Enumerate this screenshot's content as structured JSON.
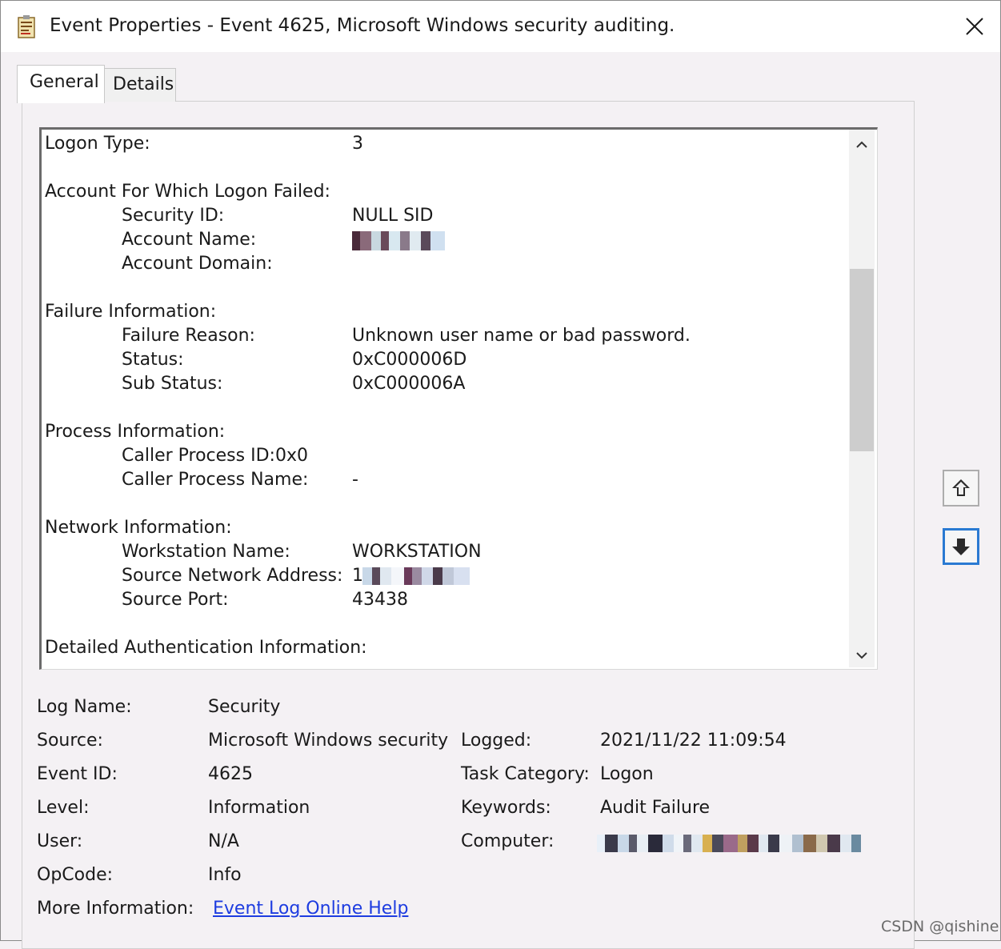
{
  "window": {
    "title": "Event Properties - Event 4625, Microsoft Windows security auditing."
  },
  "tabs": [
    {
      "label": "General",
      "active": true
    },
    {
      "label": "Details",
      "active": false
    }
  ],
  "description": {
    "logon_type_label": "Logon Type:",
    "logon_type_value": "3",
    "account_header": "Account For Which Logon Failed:",
    "security_id_label": "Security ID:",
    "security_id_value": "NULL SID",
    "account_name_label": "Account Name:",
    "account_domain_label": "Account Domain:",
    "failure_header": "Failure Information:",
    "failure_reason_label": "Failure Reason:",
    "failure_reason_value": "Unknown user name or bad password.",
    "status_label": "Status:",
    "status_value": "0xC000006D",
    "sub_status_label": "Sub Status:",
    "sub_status_value": "0xC000006A",
    "process_header": "Process Information:",
    "caller_pid_label": "Caller Process ID:",
    "caller_pid_value": "0x0",
    "caller_name_label": "Caller Process Name:",
    "caller_name_value": "-",
    "network_header": "Network Information:",
    "workstation_label": "Workstation Name:",
    "workstation_value": "WORKSTATION",
    "source_addr_label": "Source Network Address:",
    "source_addr_prefix": "1",
    "source_port_label": "Source Port:",
    "source_port_value": "43438",
    "auth_header": "Detailed Authentication Information:"
  },
  "details": {
    "log_name_label": "Log Name:",
    "log_name_value": "Security",
    "source_label": "Source:",
    "source_value": "Microsoft Windows security",
    "logged_label": "Logged:",
    "logged_value": "2021/11/22 11:09:54",
    "event_id_label": "Event ID:",
    "event_id_value": "4625",
    "task_category_label": "Task Category:",
    "task_category_value": "Logon",
    "level_label": "Level:",
    "level_value": "Information",
    "keywords_label": "Keywords:",
    "keywords_value": "Audit Failure",
    "user_label": "User:",
    "user_value": "N/A",
    "computer_label": "Computer:",
    "opcode_label": "OpCode:",
    "opcode_value": "Info",
    "more_info_label": "More Information:",
    "more_info_link": "Event Log Online Help"
  },
  "watermark": "CSDN @qishine",
  "colors": {
    "link": "#1d3ce0",
    "focus_border": "#2a7ad2",
    "background": "#f4f1f4"
  },
  "icons": [
    "event-log-icon",
    "close-icon",
    "scroll-up-icon",
    "scroll-down-icon",
    "arrow-up-icon",
    "arrow-down-icon"
  ]
}
